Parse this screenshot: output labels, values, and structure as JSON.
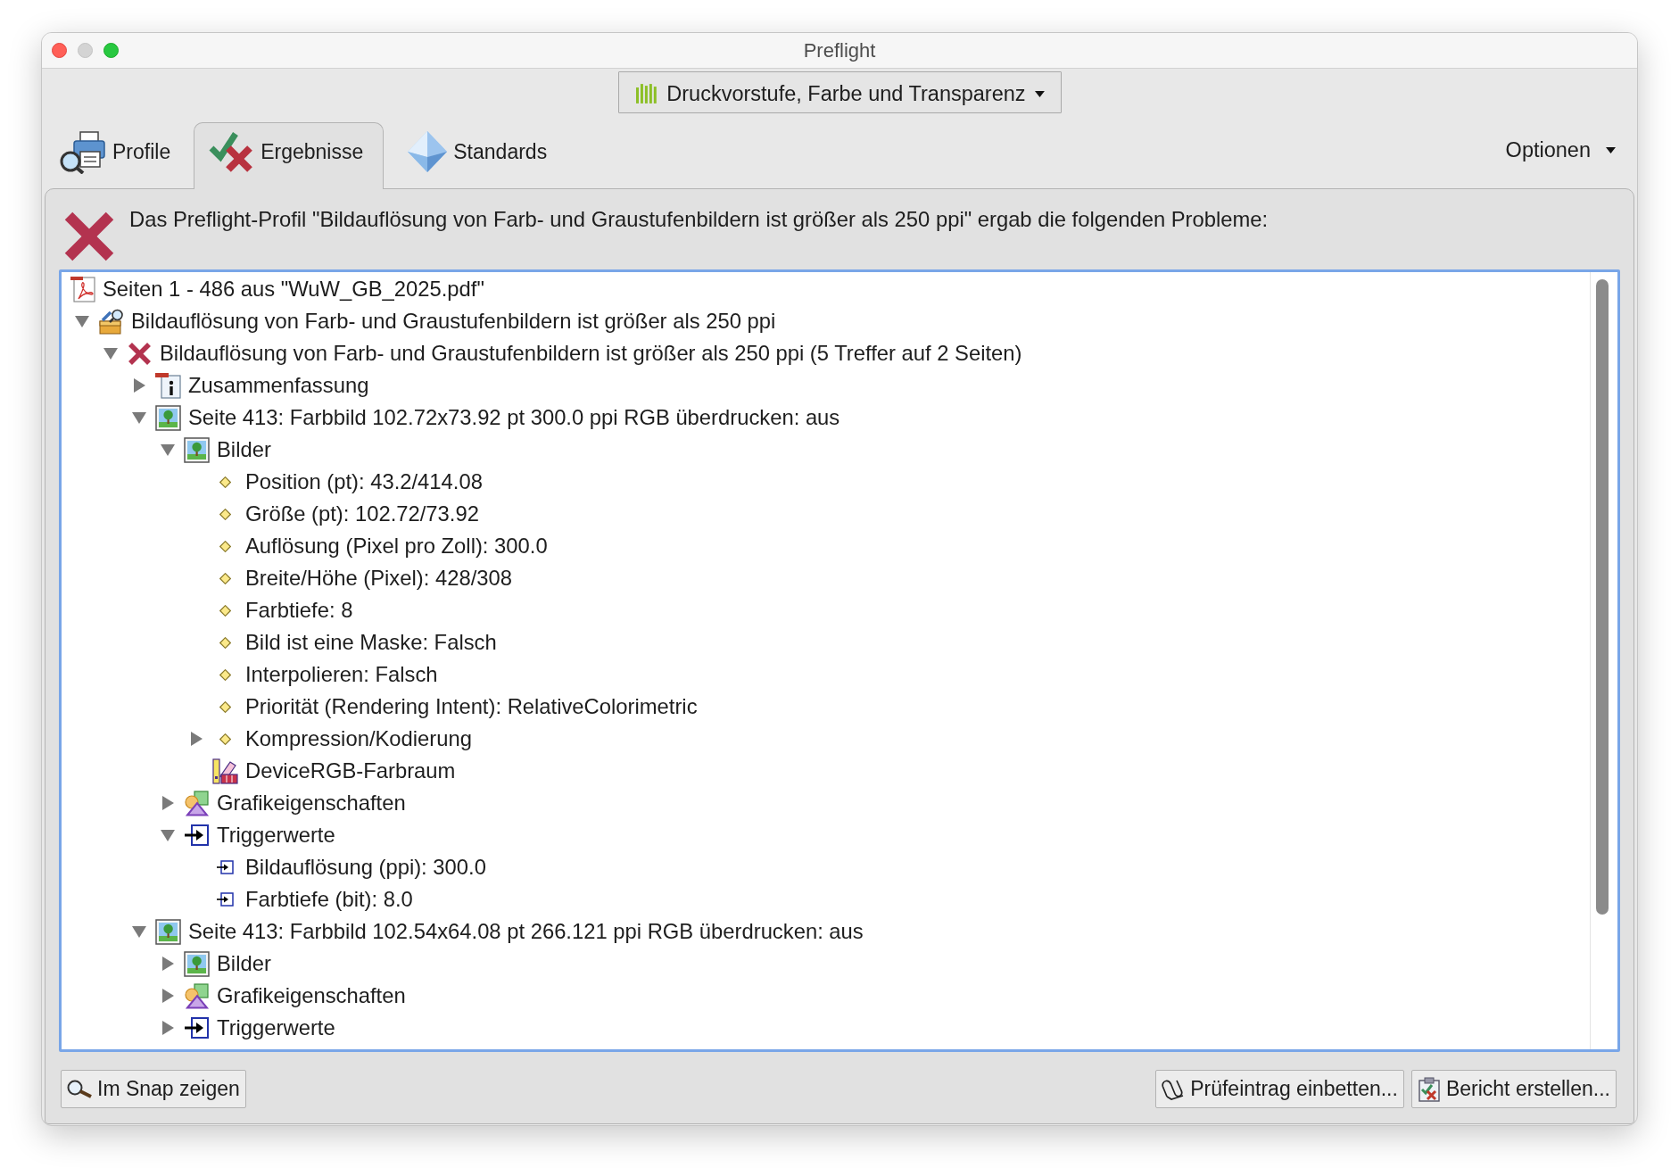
{
  "window": {
    "title": "Preflight",
    "controls": [
      {
        "kind": "close",
        "disabled": false
      },
      {
        "kind": "minimize",
        "disabled": true
      },
      {
        "kind": "zoom",
        "disabled": false
      }
    ]
  },
  "profile_dropdown": {
    "value": "Druckvorstufe, Farbe und Transparenz"
  },
  "tabs": [
    {
      "kind": "profiles",
      "label": "Profile",
      "selected": false
    },
    {
      "kind": "results",
      "label": "Ergebnisse",
      "selected": true
    },
    {
      "kind": "standards",
      "label": "Standards",
      "selected": false
    }
  ],
  "options_menu": {
    "label": "Optionen"
  },
  "result": {
    "failed": true,
    "message": "Das Preflight-Profil \"Bildauflösung von Farb- und Graustufenbildern ist größer als 250 ppi\" ergab die folgenden Probleme:"
  },
  "results_tree": {
    "kind": "pdf",
    "label": "Seiten 1 - 486 aus \"WuW_GB_2025.pdf\"",
    "children": [
      {
        "kind": "profile",
        "label": "Bildauflösung von Farb- und Graustufenbildern ist größer als 250 ppi",
        "expanded": true,
        "children": [
          {
            "kind": "error",
            "label": "Bildauflösung von Farb- und Graustufenbildern ist größer als 250 ppi (5 Treffer auf 2 Seiten)",
            "expanded": true,
            "children": [
              {
                "kind": "info",
                "label": "Zusammenfassung",
                "expanded": false
              },
              {
                "kind": "image",
                "label": "Seite 413: Farbbild 102.72x73.92 pt 300.0 ppi RGB überdrucken: aus",
                "expanded": true,
                "children": [
                  {
                    "kind": "image",
                    "label": "Bilder",
                    "expanded": true,
                    "children": [
                      {
                        "kind": "property",
                        "label": "Position (pt): 43.2/414.08"
                      },
                      {
                        "kind": "property",
                        "label": "Größe (pt): 102.72/73.92"
                      },
                      {
                        "kind": "property",
                        "label": "Auflösung (Pixel pro Zoll): 300.0"
                      },
                      {
                        "kind": "property",
                        "label": "Breite/Höhe (Pixel): 428/308"
                      },
                      {
                        "kind": "property",
                        "label": "Farbtiefe: 8"
                      },
                      {
                        "kind": "property",
                        "label": "Bild ist eine Maske: Falsch"
                      },
                      {
                        "kind": "property",
                        "label": "Interpolieren: Falsch"
                      },
                      {
                        "kind": "property",
                        "label": "Priorität (Rendering Intent): RelativeColorimetric"
                      },
                      {
                        "kind": "property",
                        "label": "Kompression/Kodierung",
                        "expanded": false
                      },
                      {
                        "kind": "colorspace",
                        "label": "DeviceRGB-Farbraum"
                      }
                    ]
                  },
                  {
                    "kind": "graphic",
                    "label": "Grafikeigenschaften",
                    "expanded": false
                  },
                  {
                    "kind": "trigger",
                    "label": "Triggerwerte",
                    "expanded": true,
                    "children": [
                      {
                        "kind": "trigger_value",
                        "label": "Bildauflösung (ppi): 300.0"
                      },
                      {
                        "kind": "trigger_value",
                        "label": "Farbtiefe (bit): 8.0"
                      }
                    ]
                  }
                ]
              },
              {
                "kind": "image",
                "label": "Seite 413: Farbbild 102.54x64.08 pt 266.121 ppi RGB überdrucken: aus",
                "expanded": true,
                "children": [
                  {
                    "kind": "image",
                    "label": "Bilder",
                    "expanded": false
                  },
                  {
                    "kind": "graphic",
                    "label": "Grafikeigenschaften",
                    "expanded": false
                  },
                  {
                    "kind": "trigger",
                    "label": "Triggerwerte",
                    "expanded": false
                  }
                ]
              }
            ]
          }
        ]
      }
    ]
  },
  "footer": {
    "left_buttons": [
      {
        "kind": "snap",
        "label": "Im Snap zeigen"
      }
    ],
    "right_buttons": [
      {
        "kind": "embed",
        "label": "Prüfeintrag einbetten..."
      },
      {
        "kind": "report",
        "label": "Bericht erstellen..."
      }
    ]
  }
}
